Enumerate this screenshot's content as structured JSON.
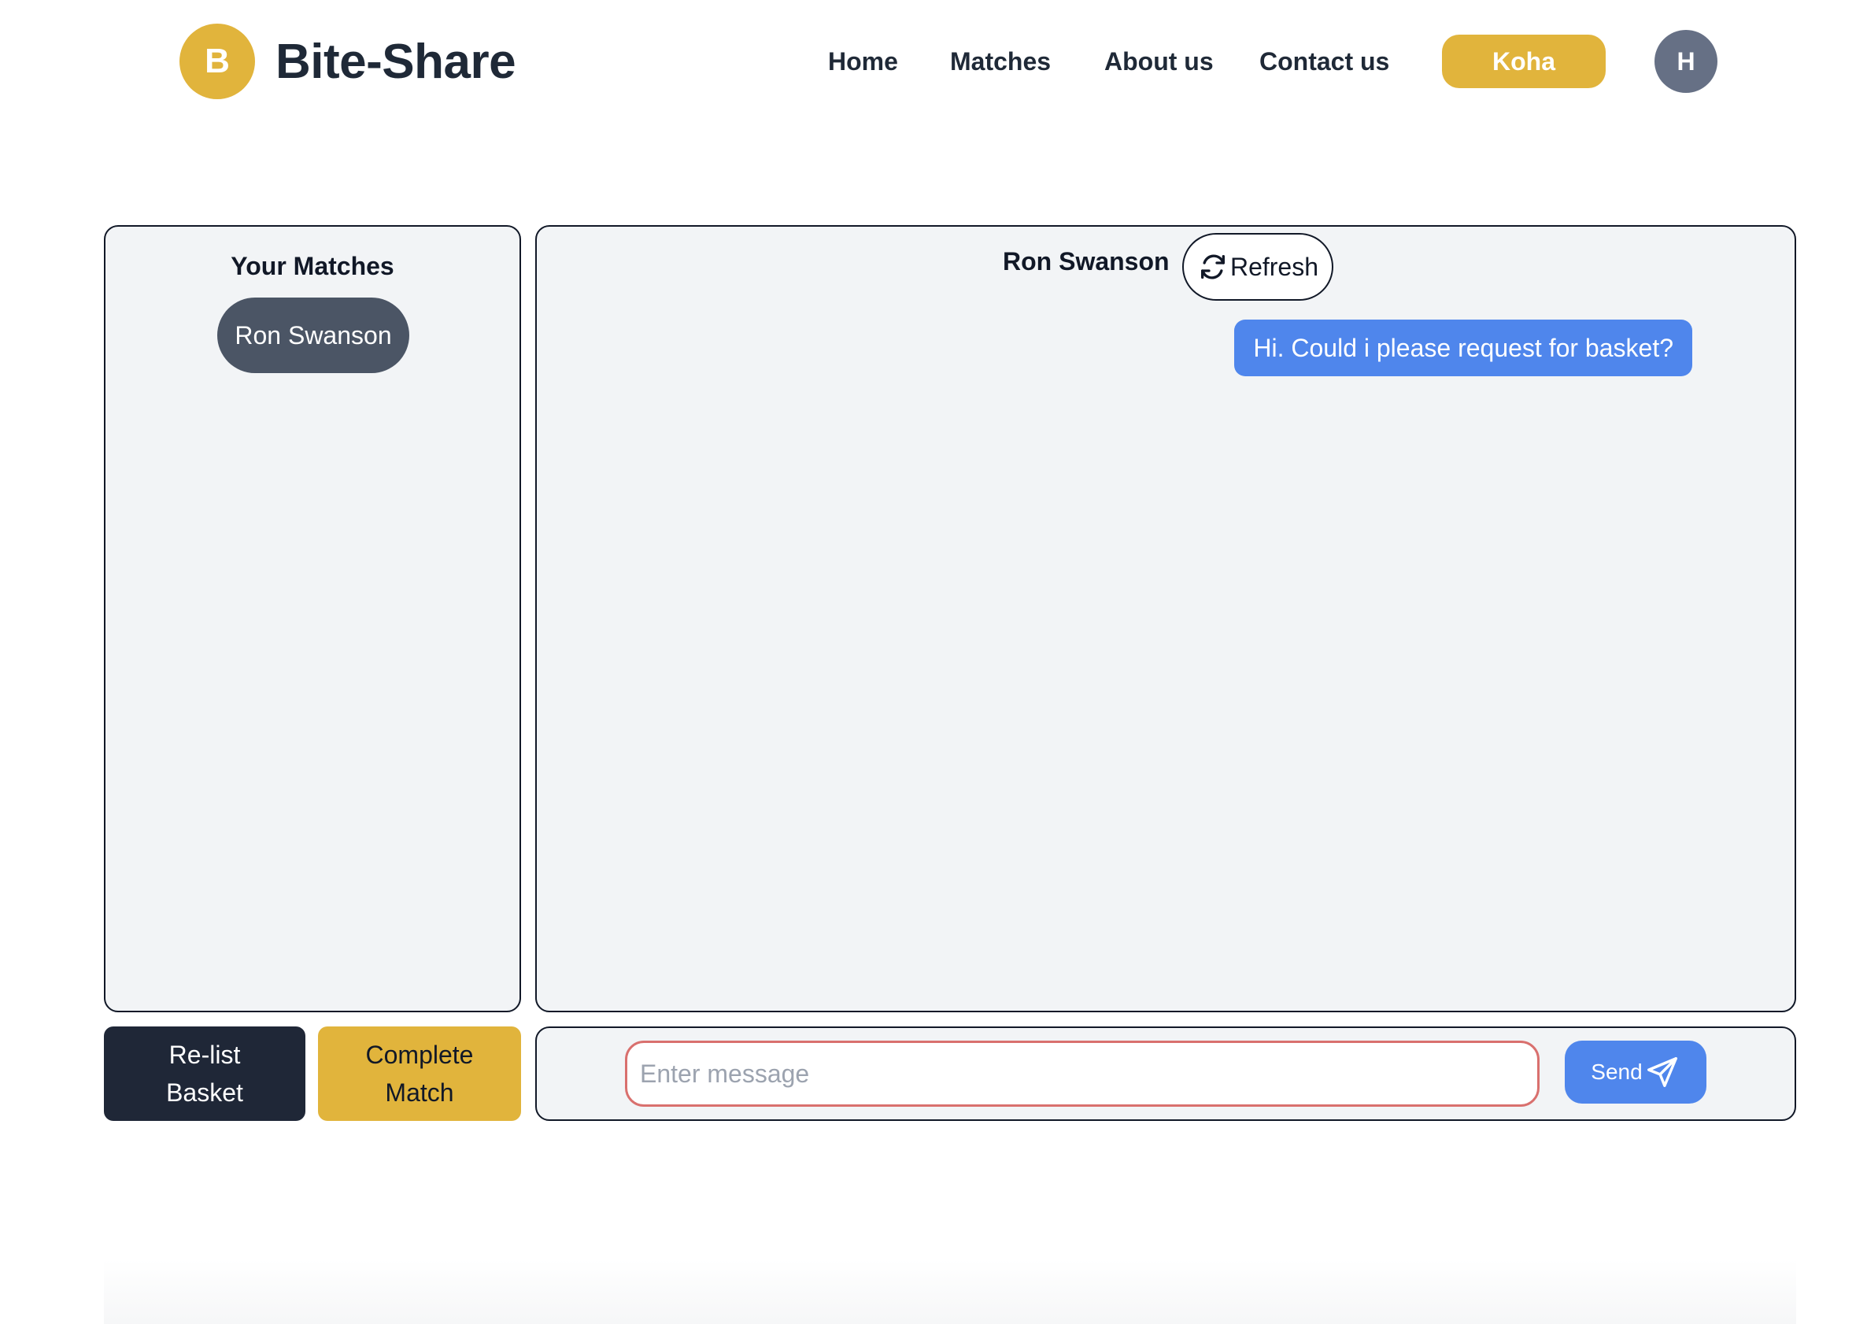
{
  "header": {
    "logo_letter": "B",
    "app_name": "Bite-Share",
    "nav": {
      "home": "Home",
      "matches": "Matches",
      "about": "About us",
      "contact": "Contact us"
    },
    "koha_label": "Koha",
    "avatar_initial": "H"
  },
  "matches_panel": {
    "title": "Your Matches",
    "items": [
      {
        "name": "Ron Swanson"
      }
    ]
  },
  "chat": {
    "contact_name": "Ron Swanson",
    "refresh_label": "Refresh",
    "messages": [
      {
        "text": "Hi. Could i please request for basket?",
        "from": "me"
      }
    ]
  },
  "actions": {
    "relist_label": "Re-list Basket",
    "complete_label": "Complete Match"
  },
  "composer": {
    "placeholder": "Enter message",
    "value": "",
    "send_label": "Send"
  },
  "colors": {
    "brand": "#e1b43c",
    "primary_blue": "#4f86ec",
    "dark": "#1f2737",
    "panel_bg": "#f2f4f6",
    "match_pill": "#4b5565",
    "avatar": "#667085",
    "input_border": "#d9706e"
  },
  "icons": {
    "refresh": "refresh-icon",
    "send": "send-icon"
  }
}
